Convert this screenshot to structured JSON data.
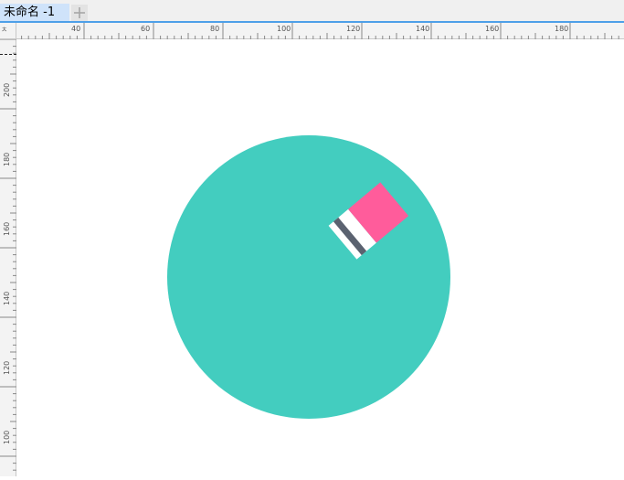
{
  "document_tab": {
    "title": "未命名 -1"
  },
  "new_tab": {
    "icon": "plus-icon"
  },
  "horizontal_ruler": {
    "labels": [
      "40",
      "60",
      "80",
      "100",
      "120",
      "140",
      "160",
      "180"
    ]
  },
  "vertical_ruler": {
    "labels": [
      "200",
      "180",
      "160",
      "140",
      "120",
      "100"
    ]
  },
  "ruler_corner": {
    "label": "ㅊ"
  },
  "artwork": {
    "circle_color": "#43cdbf",
    "eraser_cap_color": "#ff5c9b",
    "eraser_band_color": "#5b6270",
    "eraser_gap_color": "#ffffff"
  },
  "colors": {
    "tab_active": "#cfe3fa",
    "tab_underline": "#4ea0e8",
    "ruler_bg": "#f3f3f3"
  }
}
